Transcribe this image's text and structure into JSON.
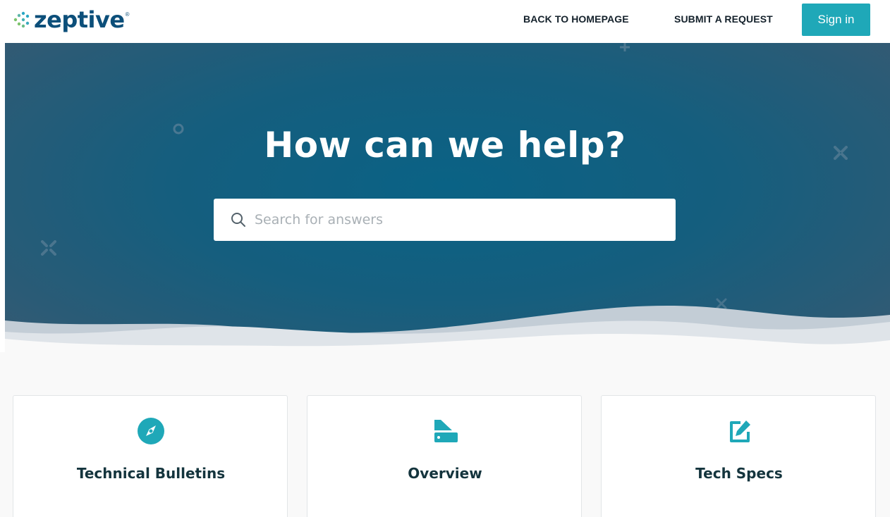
{
  "header": {
    "logo_text": "zeptive",
    "logo_mark": "®",
    "nav": {
      "home": "BACK TO HOMEPAGE",
      "request": "SUBMIT A REQUEST"
    },
    "signin": "Sign in"
  },
  "hero": {
    "title": "How can we help?",
    "search": {
      "placeholder": "Search for answers",
      "value": "",
      "icon": "search-icon"
    }
  },
  "categories": [
    {
      "title": "Technical Bulletins",
      "icon": "compass-icon"
    },
    {
      "title": "Overview",
      "icon": "swatchbook-icon"
    },
    {
      "title": "Tech Specs",
      "icon": "edit-icon"
    }
  ],
  "colors": {
    "accent": "#1fa8b8",
    "brand": "#0c4f7a",
    "hero_dark": "#2f5a73",
    "hero_light": "#0a6285",
    "card_title": "#14343d"
  }
}
